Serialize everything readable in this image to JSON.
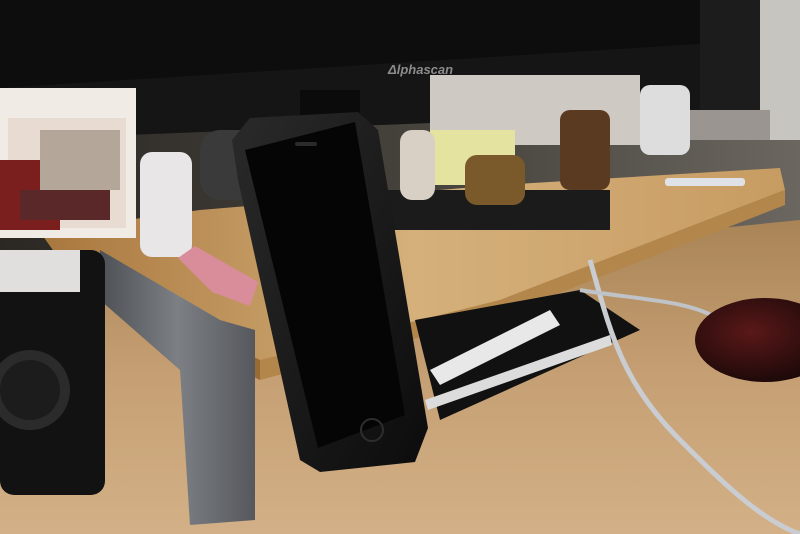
{
  "scene": {
    "monitor_brand": "Δlphascan"
  },
  "colors": {
    "desk": "#c9a478",
    "shelf_wood": "#c8a06a",
    "shelf_edge": "#9a6a34",
    "metal_leg": "#6b6e72",
    "phone_body": "#121212",
    "monitor": "#111111",
    "wall": "#2a2622"
  }
}
